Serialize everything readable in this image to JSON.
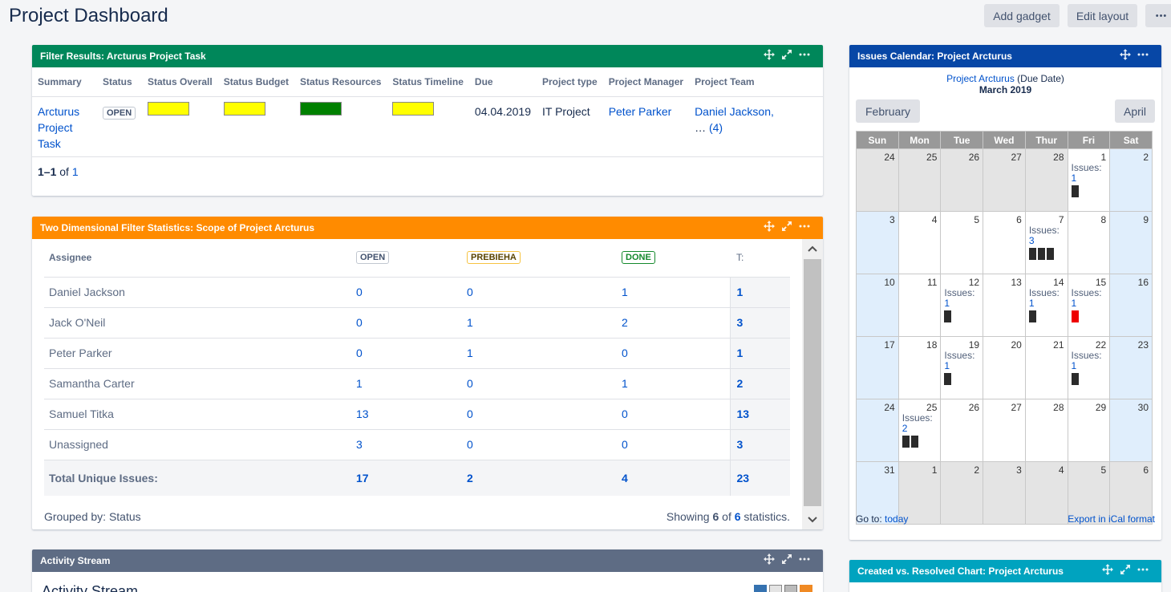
{
  "page": {
    "title": "Project Dashboard"
  },
  "toolbar": {
    "add_gadget": "Add gadget",
    "edit_layout": "Edit layout",
    "more": "•••"
  },
  "colors": {
    "green_header": "#00875a",
    "orange_header": "#ff8b00",
    "slate_header": "#5e6c84",
    "blue_header": "#0747a6",
    "teal_header": "#00a3bf",
    "link": "#0052cc"
  },
  "filter_results": {
    "title": "Filter Results: Arcturus Project Task",
    "columns": [
      "Summary",
      "Status",
      "Status Overall",
      "Status Budget",
      "Status Resources",
      "Status Timeline",
      "Due",
      "Project type",
      "Project Manager",
      "Project Team"
    ],
    "row": {
      "summary_lines": [
        "Arcturus",
        "Project",
        "Task"
      ],
      "status": "OPEN",
      "status_overall_color": "#ffff00",
      "status_budget_color": "#ffff00",
      "status_resources_color": "#008000",
      "status_timeline_color": "#ffff00",
      "due": "04.04.2019",
      "project_type": "IT Project",
      "project_manager": "Peter Parker",
      "project_team": "Daniel Jackson,",
      "project_team_more": "(4)",
      "project_team_ellipsis": "…"
    },
    "pagination": {
      "range": "1–1",
      "of": "of",
      "total": "1"
    }
  },
  "two_dim": {
    "title": "Two Dimensional Filter Statistics: Scope of Project Arcturus",
    "headers": {
      "assignee": "Assignee",
      "open": "OPEN",
      "prebieha": "PREBIEHA",
      "done": "DONE",
      "total": "T:"
    },
    "rows": [
      {
        "name": "Daniel Jackson",
        "open": "0",
        "prebieha": "0",
        "done": "1",
        "total": "1"
      },
      {
        "name": "Jack O'Neil",
        "open": "0",
        "prebieha": "1",
        "done": "2",
        "total": "3"
      },
      {
        "name": "Peter Parker",
        "open": "0",
        "prebieha": "1",
        "done": "0",
        "total": "1"
      },
      {
        "name": "Samantha Carter",
        "open": "1",
        "prebieha": "0",
        "done": "1",
        "total": "2"
      },
      {
        "name": "Samuel Titka",
        "open": "13",
        "prebieha": "0",
        "done": "0",
        "total": "13"
      },
      {
        "name": "Unassigned",
        "open": "3",
        "prebieha": "0",
        "done": "0",
        "total": "3"
      }
    ],
    "totals": {
      "label": "Total Unique Issues:",
      "open": "17",
      "prebieha": "2",
      "done": "4",
      "total": "23"
    },
    "footer": {
      "grouped": "Grouped by: Status",
      "showing_prefix": "Showing",
      "shown": "6",
      "of": "of",
      "count": "6",
      "suffix": "statistics."
    }
  },
  "activity": {
    "title": "Activity Stream",
    "heading": "Activity Stream"
  },
  "calendar": {
    "title": "Issues Calendar: Project Arcturus",
    "project": "Project Arcturus",
    "date_type": "(Due Date)",
    "month": "March 2019",
    "prev": "February",
    "next": "April",
    "weekdays": [
      "Sun",
      "Mon",
      "Tue",
      "Wed",
      "Thur",
      "Fri",
      "Sat"
    ],
    "weeks": [
      [
        {
          "d": "24",
          "t": "other"
        },
        {
          "d": "25",
          "t": "other"
        },
        {
          "d": "26",
          "t": "other"
        },
        {
          "d": "27",
          "t": "other"
        },
        {
          "d": "28",
          "t": "other"
        },
        {
          "d": "1",
          "t": "cur",
          "issues": "1",
          "bars": [
            "#2b2b2b"
          ]
        },
        {
          "d": "2",
          "t": "weekend"
        }
      ],
      [
        {
          "d": "3",
          "t": "weekend"
        },
        {
          "d": "4",
          "t": "cur"
        },
        {
          "d": "5",
          "t": "cur"
        },
        {
          "d": "6",
          "t": "cur"
        },
        {
          "d": "7",
          "t": "cur",
          "issues": "3",
          "bars": [
            "#2b2b2b",
            "#2b2b2b",
            "#2b2b2b"
          ]
        },
        {
          "d": "8",
          "t": "cur"
        },
        {
          "d": "9",
          "t": "weekend"
        }
      ],
      [
        {
          "d": "10",
          "t": "weekend"
        },
        {
          "d": "11",
          "t": "cur"
        },
        {
          "d": "12",
          "t": "cur",
          "issues": "1",
          "bars": [
            "#2b2b2b"
          ]
        },
        {
          "d": "13",
          "t": "cur"
        },
        {
          "d": "14",
          "t": "cur",
          "issues": "1",
          "bars": [
            "#2b2b2b"
          ]
        },
        {
          "d": "15",
          "t": "cur",
          "issues": "1",
          "bars": [
            "#ee0000"
          ]
        },
        {
          "d": "16",
          "t": "weekend"
        }
      ],
      [
        {
          "d": "17",
          "t": "weekend"
        },
        {
          "d": "18",
          "t": "cur"
        },
        {
          "d": "19",
          "t": "cur",
          "issues": "1",
          "bars": [
            "#2b2b2b"
          ]
        },
        {
          "d": "20",
          "t": "cur"
        },
        {
          "d": "21",
          "t": "cur"
        },
        {
          "d": "22",
          "t": "cur",
          "issues": "1",
          "bars": [
            "#2b2b2b"
          ]
        },
        {
          "d": "23",
          "t": "weekend"
        }
      ],
      [
        {
          "d": "24",
          "t": "weekend"
        },
        {
          "d": "25",
          "t": "cur",
          "issues": "2",
          "bars": [
            "#2b2b2b",
            "#2b2b2b"
          ]
        },
        {
          "d": "26",
          "t": "cur"
        },
        {
          "d": "27",
          "t": "cur"
        },
        {
          "d": "28",
          "t": "cur"
        },
        {
          "d": "29",
          "t": "cur"
        },
        {
          "d": "30",
          "t": "weekend"
        }
      ],
      [
        {
          "d": "31",
          "t": "weekend"
        },
        {
          "d": "1",
          "t": "other"
        },
        {
          "d": "2",
          "t": "other"
        },
        {
          "d": "3",
          "t": "other"
        },
        {
          "d": "4",
          "t": "other"
        },
        {
          "d": "5",
          "t": "other"
        },
        {
          "d": "6",
          "t": "other"
        }
      ]
    ],
    "issues_label": "Issues:",
    "goto_label": "Go to:",
    "today": "today",
    "export": "Export in iCal format"
  },
  "created_resolved": {
    "title": "Created vs. Resolved Chart: Project Arcturus"
  },
  "icons": {
    "move": "move-icon",
    "expand": "expand-icon",
    "more": "more-icon"
  }
}
